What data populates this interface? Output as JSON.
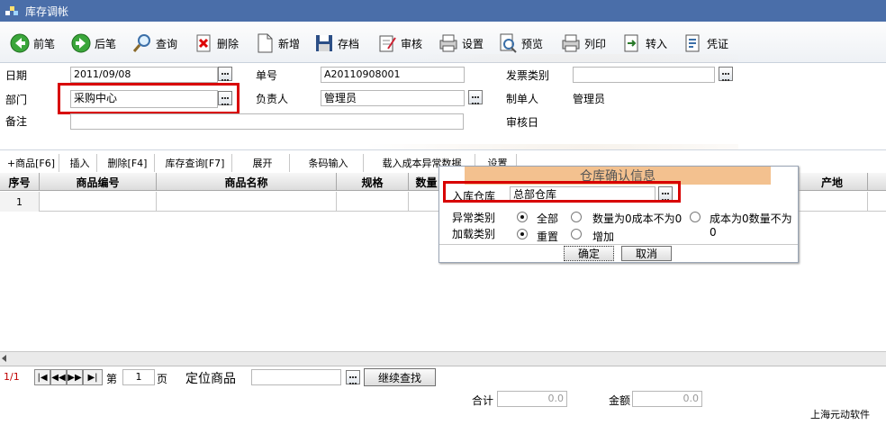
{
  "window": {
    "title": "库存调帐"
  },
  "toolbar": {
    "buttons": [
      {
        "label": "前笔",
        "icon": "prev-arrow-icon"
      },
      {
        "label": "后笔",
        "icon": "next-arrow-icon"
      },
      {
        "label": "查询",
        "icon": "magnifier-icon"
      },
      {
        "label": "删除",
        "icon": "delete-doc-icon"
      },
      {
        "label": "新增",
        "icon": "new-doc-icon"
      },
      {
        "label": "存档",
        "icon": "floppy-disk-icon"
      },
      {
        "label": "审核",
        "icon": "review-pen-icon"
      },
      {
        "label": "设置",
        "icon": "printer-settings-icon"
      },
      {
        "label": "预览",
        "icon": "print-preview-icon"
      },
      {
        "label": "列印",
        "icon": "printer-icon"
      },
      {
        "label": "转入",
        "icon": "import-icon"
      },
      {
        "label": "凭证",
        "icon": "voucher-icon"
      }
    ]
  },
  "form": {
    "date_label": "日期",
    "date_value": "2011/09/08",
    "dept_label": "部门",
    "dept_value": "采购中心",
    "note_label": "备注",
    "note_value": "",
    "order_no_label": "单号",
    "order_no_value": "A20110908001",
    "owner_label": "负责人",
    "owner_value": "管理员",
    "invoice_type_label": "发票类别",
    "invoice_type_value": "",
    "creator_label": "制单人",
    "creator_value": "管理员",
    "review_date_label": "审核日",
    "review_date_value": ""
  },
  "subtoolbar": {
    "buttons": [
      "+商品[F6]",
      "插入",
      "删除[F4]",
      "库存查询[F7]",
      "展开",
      "条码输入",
      "载入成本异常数据",
      "设置"
    ]
  },
  "grid": {
    "columns": [
      "序号",
      "商品编号",
      "商品名称",
      "规格",
      "数量",
      "产地"
    ],
    "rows": [
      {
        "index": "1"
      }
    ]
  },
  "pager": {
    "page_indicator": "1/1",
    "page_prefix": "第",
    "page_value": "1",
    "page_suffix": "页",
    "locate_label": "定位商品",
    "locate_value": "",
    "continue_label": "继续查找"
  },
  "totals": {
    "sum_label": "合计",
    "sum_value": "0.0",
    "amount_label": "金额",
    "amount_value": "0.0",
    "company": "上海元动软件"
  },
  "dialog": {
    "title": "仓库确认信息",
    "warehouse_label": "入库仓库",
    "warehouse_value": "总部仓库",
    "anomaly_label": "异常类别",
    "anomaly_options": [
      "全部",
      "数量为0成本不为0",
      "成本为0数量不为0"
    ],
    "anomaly_selected": 0,
    "load_label": "加载类别",
    "load_options": [
      "重置",
      "增加"
    ],
    "load_selected": 0,
    "ok_label": "确定",
    "cancel_label": "取消"
  },
  "colors": {
    "titlebar": "#4a6ea9",
    "highlight_box": "#d80000",
    "dialog_title": "#f3c18f"
  }
}
